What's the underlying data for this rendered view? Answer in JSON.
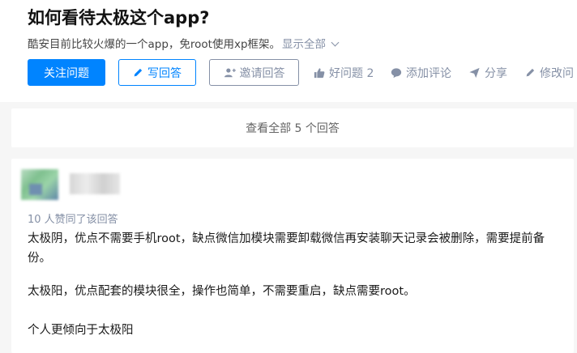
{
  "question": {
    "title": "如何看待太极这个app?",
    "description": "酷安目前比较火爆的一个app，免root使用xp框架。",
    "show_all": "显示全部"
  },
  "actions": {
    "follow": "关注问题",
    "write": "写回答",
    "invite": "邀请回答",
    "good_question": "好问题 2",
    "add_comment": "添加评论",
    "share": "分享",
    "edit": "修改问"
  },
  "view_all": "查看全部 5 个回答",
  "answer": {
    "votes": "10 人赞同了该回答",
    "paragraphs": [
      "太极阴，优点不需要手机root，缺点微信加模块需要卸载微信再安装聊天记录会被删除，需要提前备份。",
      "太极阳，优点配套的模块很全，操作也简单，不需要重启，缺点需要root。",
      "个人更倾向于太极阳"
    ]
  },
  "colors": {
    "primary": "#0084ff",
    "muted": "#8590a6",
    "background": "#f6f6f6"
  }
}
